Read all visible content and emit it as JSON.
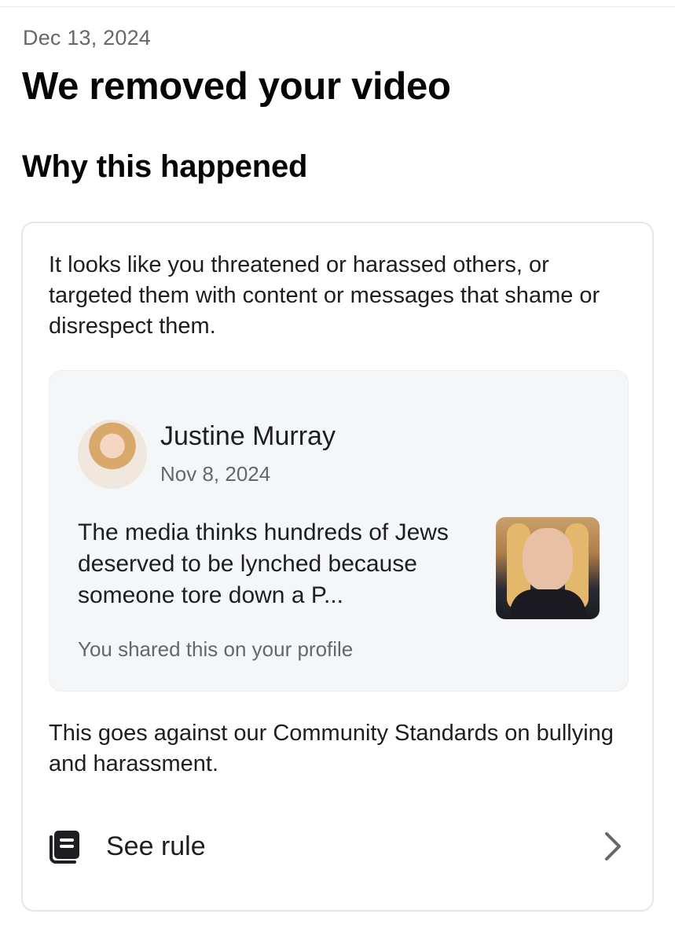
{
  "header": {
    "date": "Dec 13, 2024",
    "title": "We removed your video"
  },
  "section": {
    "title": "Why this happened"
  },
  "card": {
    "reason": "It looks like you threatened or harassed others, or targeted them with content or messages that shame or disrespect them.",
    "post": {
      "author": "Justine Murray",
      "date": "Nov 8, 2024",
      "text": "The media thinks hundreds of Jews deserved to be lynched because someone tore down a P...",
      "shared_note": "You shared this on your profile"
    },
    "violation": "This goes against our Community Standards on bullying and harassment.",
    "rule_link": {
      "label": "See rule",
      "icon": "rulebook-icon"
    }
  },
  "colors": {
    "text_primary": "#1c1e21",
    "text_secondary": "#65676b",
    "card_border": "#e4e6eb",
    "post_background": "#f5f6f8"
  }
}
